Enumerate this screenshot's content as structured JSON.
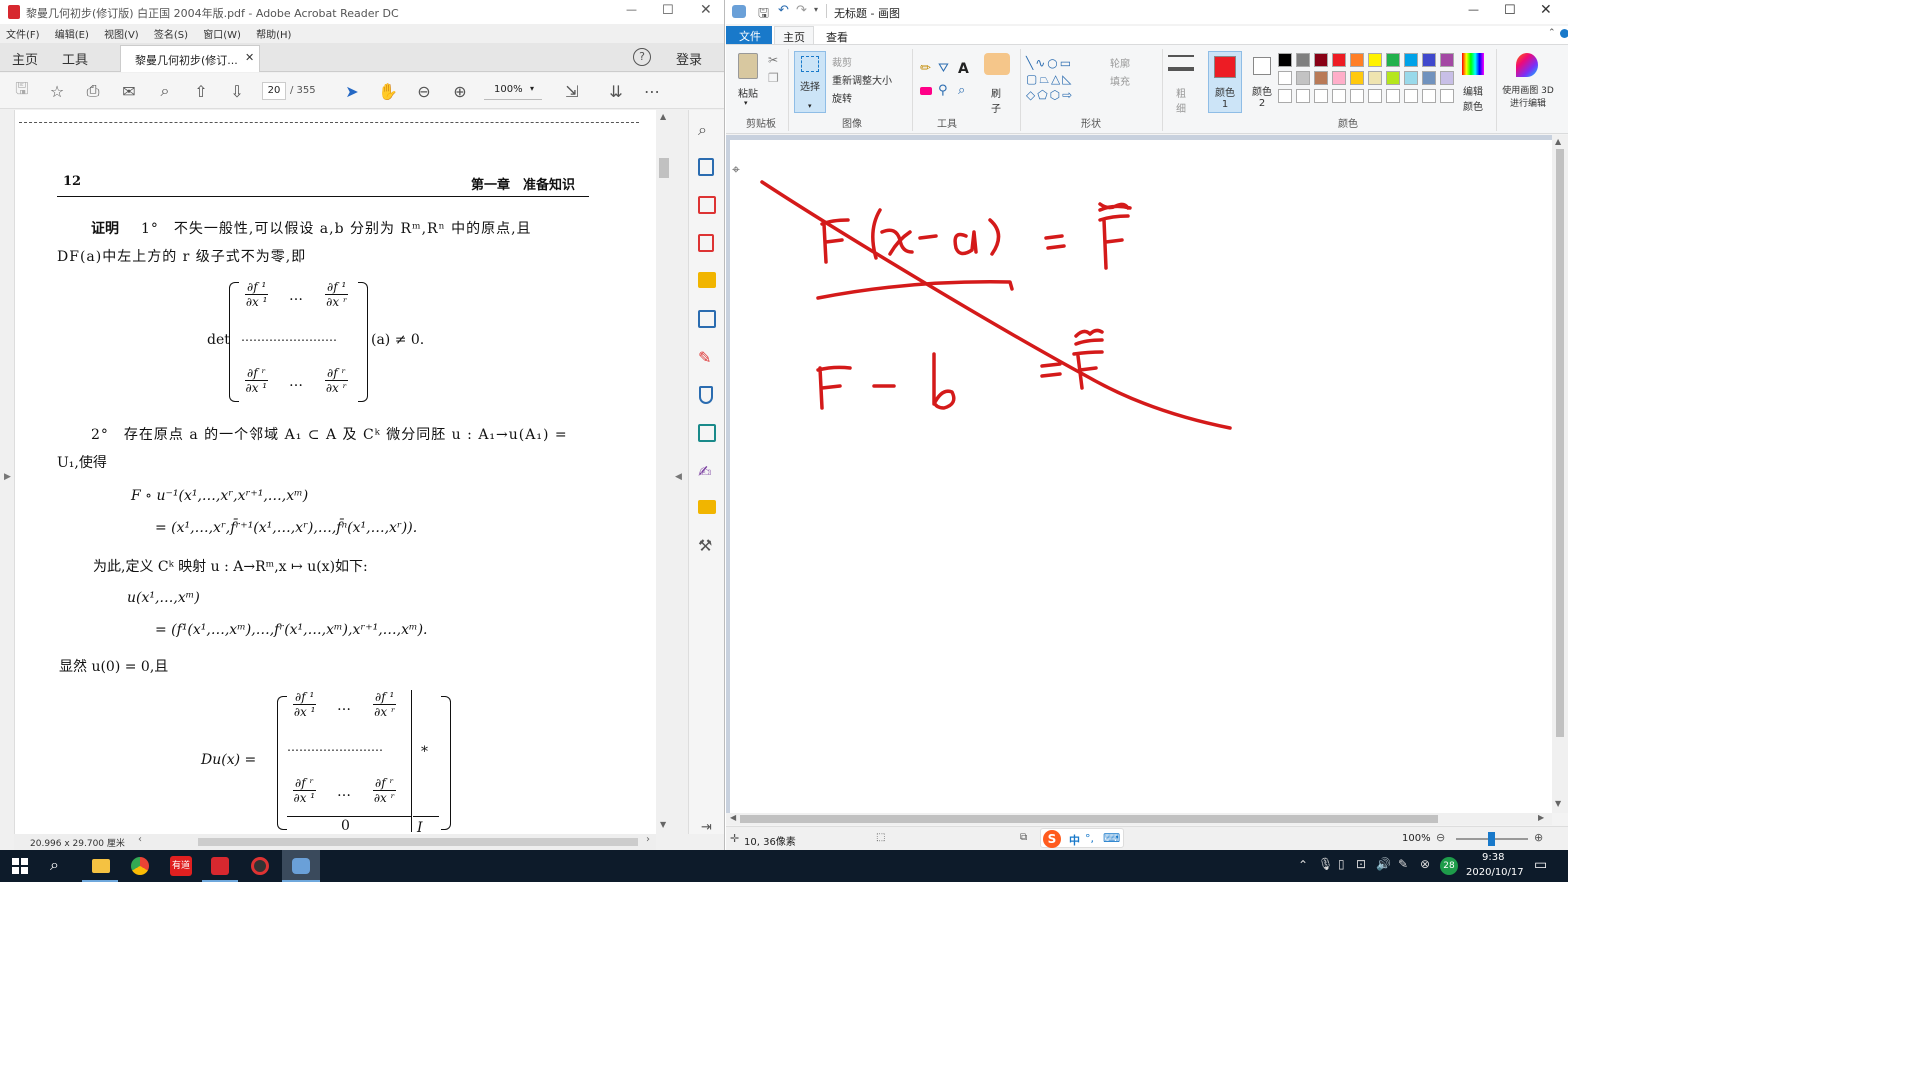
{
  "acrobat": {
    "title": "黎曼几何初步(修订版) 白正国 2004年版.pdf - Adobe Acrobat Reader DC",
    "menu": [
      "文件(F)",
      "编辑(E)",
      "视图(V)",
      "签名(S)",
      "窗口(W)",
      "帮助(H)"
    ],
    "tabs": {
      "home": "主页",
      "tools": "工具",
      "doc": "黎曼几何初步(修订...",
      "login": "登录"
    },
    "page_current": "20",
    "page_total": "/ 355",
    "zoom": "100%",
    "page_size": "20.996 x 29.700 厘米",
    "page": {
      "number": "12",
      "chapter": "第一章　准备知识",
      "proof_label": "证明",
      "p1a": "1°　不失一般性,可以假设 a,b 分别为 Rᵐ,Rⁿ 中的原点,且",
      "p1b": "DF(a)中左上方的 r 级子式不为零,即",
      "det_label": "det",
      "det_rhs": "(a) ≠ 0.",
      "d_f1": "∂f ¹",
      "d_fr": "∂f ʳ",
      "d_x1": "∂x ¹",
      "d_xr": "∂x ʳ",
      "dots_h": "…",
      "dots_row": "……………………",
      "p2a": "2°　存在原点 a 的一个邻域 A₁ ⊂ A 及 Cᵏ 微分同胚 u : A₁→u(A₁) =",
      "p2b": "U₁,使得",
      "eq1": "F ∘ u⁻¹(x¹,…,xʳ,xʳ⁺¹,…,xᵐ)",
      "eq2": "= (x¹,…,xʳ,f̄ʳ⁺¹(x¹,…,xʳ),…,f̄ⁿ(x¹,…,xʳ)).",
      "p3": "为此,定义 Cᵏ 映射 u : A→Rᵐ,x ↦ u(x)如下:",
      "eq3": "u(x¹,…,xᵐ)",
      "eq4": "= (f¹(x¹,…,xᵐ),…,fʳ(x¹,…,xᵐ),xʳ⁺¹,…,xᵐ).",
      "p4": "显然 u(0) = 0,且",
      "du_label": "Du(x) =",
      "star": "*",
      "zero": "0",
      "ident": "I"
    }
  },
  "paint": {
    "title": "无标题 - 画图",
    "ribbon_tabs": {
      "file": "文件",
      "home": "主页",
      "view": "查看"
    },
    "clipboard": {
      "paste": "粘贴",
      "group": "剪贴板"
    },
    "image": {
      "select": "选择",
      "crop": "裁剪",
      "resize": "重新调整大小",
      "rotate": "旋转",
      "group": "图像"
    },
    "tools_group": "工具",
    "brush": "刷子",
    "shapes": {
      "outline": "轮廓",
      "fill": "填充",
      "group": "形状"
    },
    "size": "粗细",
    "color1": "颜色 1",
    "color2": "颜色 2",
    "edit_colors": "编辑颜色",
    "paint3d": "使用画图 3D 进行编辑",
    "colors_group": "颜色",
    "status_pos": "10, 36像素",
    "zoom": "100%",
    "accent": "#1979ca",
    "primary_color": "#ed1c24",
    "palette": [
      "#000000",
      "#7f7f7f",
      "#880015",
      "#ed1c24",
      "#ff7f27",
      "#fff200",
      "#22b14c",
      "#00a2e8",
      "#3f48cc",
      "#a349a4",
      "#ffffff",
      "#c3c3c3",
      "#b97a57",
      "#ffaec9",
      "#ffc90e",
      "#efe4b0",
      "#b5e61d",
      "#99d9ea",
      "#7092be",
      "#c8bfe7"
    ],
    "ink_color": "#d41a1a"
  },
  "taskbar": {
    "time": "9:38",
    "date": "2020/10/17",
    "ime": "中",
    "badge": "28",
    "youdao": "有道"
  }
}
